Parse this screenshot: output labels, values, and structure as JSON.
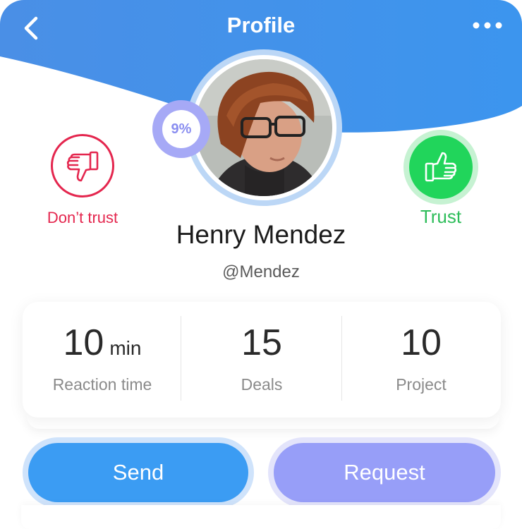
{
  "header": {
    "title": "Profile",
    "back_icon": "chevron-left-icon",
    "more_icon": "more-horizontal-icon",
    "gradient_left": "#4a8fe6",
    "gradient_right": "#3c95ee"
  },
  "profile": {
    "name": "Henry Mendez",
    "handle": "@Mendez",
    "score_badge": "9%"
  },
  "trust_actions": {
    "distrust_label": "Don’t trust",
    "distrust_icon": "thumbs-down-icon",
    "distrust_color": "#e4264e",
    "trust_label": "Trust",
    "trust_icon": "thumbs-up-icon",
    "trust_color": "#21d55b"
  },
  "stats": [
    {
      "value": "10",
      "unit": "min",
      "label": "Reaction time"
    },
    {
      "value": "15",
      "unit": "",
      "label": "Deals"
    },
    {
      "value": "10",
      "unit": "",
      "label": "Project"
    }
  ],
  "actions": {
    "send_label": "Send",
    "send_color": "#3b9cf3",
    "request_label": "Request",
    "request_color": "#979ef8"
  }
}
